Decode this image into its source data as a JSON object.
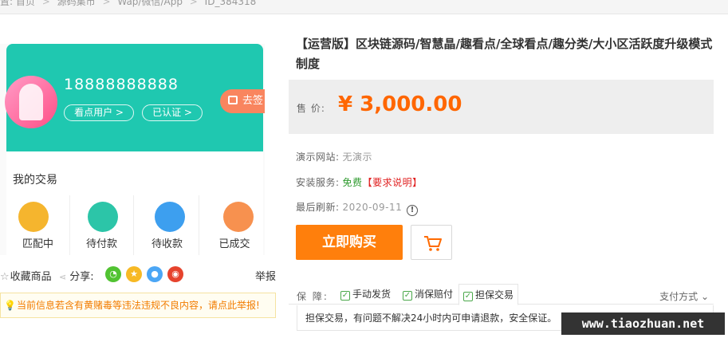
{
  "breadcrumb": {
    "prefix": "置:",
    "items": [
      "首页",
      "源码集市",
      "Wap/微信/App",
      "ID_384318"
    ],
    "separator": ">"
  },
  "preview": {
    "phone_number": "18888888888",
    "tag_user": "看点用户 >",
    "tag_verified": "已认证 >",
    "checkin": "去签",
    "section_title": "我的交易",
    "trade_items": [
      {
        "label": "匹配中",
        "color": "#f5b52e"
      },
      {
        "label": "待付款",
        "color": "#2cc5a8"
      },
      {
        "label": "待收款",
        "color": "#3d9fef"
      },
      {
        "label": "已成交",
        "color": "#f7914f"
      }
    ],
    "head_color": "#1fc8b0"
  },
  "share": {
    "favorite": "收藏商品",
    "share_label": "分享:",
    "report": "举报",
    "icons": [
      {
        "name": "wechat-icon",
        "color": "#51c332",
        "glyph": "◔"
      },
      {
        "name": "qzone-icon",
        "color": "#f7b924",
        "glyph": "★"
      },
      {
        "name": "qq-icon",
        "color": "#4ba6f5",
        "glyph": "●"
      },
      {
        "name": "weibo-icon",
        "color": "#e6432d",
        "glyph": "◉"
      }
    ]
  },
  "notice": {
    "text": "当前信息若含有黄赌毒等违法违规不良内容，请点此举报!"
  },
  "product": {
    "title": "【运营版】区块链源码/智慧晶/趣看点/全球看点/趣分类/大小区活跃度升级模式制度",
    "price_label": "售  价:",
    "price": "¥ 3,000.00",
    "demo_label": "演示网站:",
    "demo_value": "无演示",
    "install_label": "安装服务:",
    "install_value": "免费",
    "install_note": "【要求说明】",
    "refresh_label": "最后刷新:",
    "refresh_value": "2020-09-11",
    "buy_label": "立即购买",
    "accent_color": "#ff7f0c"
  },
  "guarantee": {
    "label": "保  障:",
    "items": [
      "手动发货",
      "消保赔付",
      "担保交易"
    ],
    "pay_method": "支付方式",
    "description": "担保交易，有问题不解决24小时内可申请退款，安全保证。"
  },
  "watermark": "www.tiaozhuan.net"
}
